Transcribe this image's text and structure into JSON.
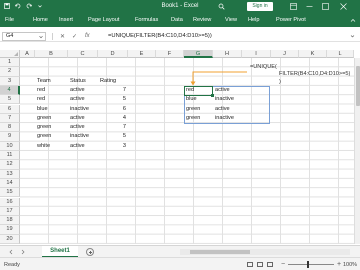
{
  "window": {
    "title": "Book1 - Excel",
    "signin": "Sign in"
  },
  "ribbon": {
    "tabs": [
      "File",
      "Home",
      "Insert",
      "Page Layout",
      "Formulas",
      "Data",
      "Review",
      "View",
      "Help",
      "Power Pivot"
    ]
  },
  "formula_bar": {
    "name_box": "G4",
    "cancel": "✕",
    "enter": "✓",
    "fx": "fx",
    "formula": "=UNIQUE(FILTER(B4:C10,D4:D10>=5))"
  },
  "columns": [
    "A",
    "B",
    "C",
    "D",
    "E",
    "F",
    "G",
    "H",
    "I",
    "J",
    "K",
    "L"
  ],
  "rows": [
    "1",
    "2",
    "3",
    "4",
    "5",
    "6",
    "7",
    "8",
    "9",
    "10",
    "11",
    "12",
    "13",
    "14",
    "15",
    "16",
    "17",
    "18",
    "19",
    "20"
  ],
  "source_table": {
    "headers": [
      "Team",
      "Status",
      "Rating"
    ],
    "rows": [
      [
        "red",
        "active",
        "7"
      ],
      [
        "red",
        "active",
        "5"
      ],
      [
        "blue",
        "inactive",
        "6"
      ],
      [
        "green",
        "active",
        "4"
      ],
      [
        "green",
        "active",
        "7"
      ],
      [
        "green",
        "inactive",
        "5"
      ],
      [
        "white",
        "active",
        "3"
      ]
    ]
  },
  "spill_result": {
    "rows": [
      [
        "red",
        "active"
      ],
      [
        "blue",
        "inactive"
      ],
      [
        "green",
        "active"
      ],
      [
        "green",
        "inactive"
      ]
    ]
  },
  "annotation": {
    "line1": "=UNIQUE(",
    "line2": "FILTER(B4:C10,D4:D10>=5)",
    "line3": ")"
  },
  "sheets": {
    "active": "Sheet1"
  },
  "status": {
    "text": "Ready",
    "zoom": "100%",
    "zoom_minus": "−",
    "zoom_plus": "+"
  },
  "colors": {
    "accent": "#217346",
    "arrow": "#f0a030",
    "spill_border": "#7aa0d6"
  }
}
